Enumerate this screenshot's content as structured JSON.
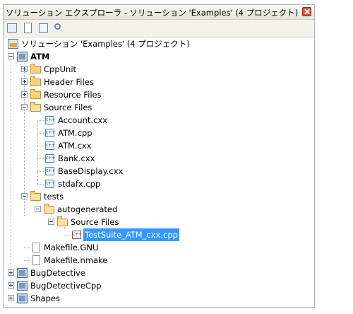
{
  "window": {
    "title": "ソリューション エクスプローラ - ソリューション 'Examples' (4 プロジェクト)"
  },
  "toolbar": {
    "buttons": [
      {
        "icon": "properties-icon"
      },
      {
        "icon": "show-all-files-icon"
      },
      {
        "icon": "refresh-icon"
      },
      {
        "icon": "view-class-diagram-icon"
      }
    ]
  },
  "tree": {
    "solution": "ソリューション 'Examples' (4 プロジェクト)",
    "atm": "ATM",
    "cppunit": "CppUnit",
    "header_files": "Header Files",
    "resource_files": "Resource Files",
    "source_files": "Source Files",
    "files": [
      "Account.cxx",
      "ATM.cpp",
      "ATM.cxx",
      "Bank.cxx",
      "BaseDisplay.cxx",
      "stdafx.cpp"
    ],
    "tests": "tests",
    "autogenerated": "autogenerated",
    "tests_source_files": "Source Files",
    "selected_file": "TestSuite_ATM_cxx.cpp",
    "makefile_gnu": "Makefile.GNU",
    "makefile_nmake": "Makefile.nmake",
    "bugdetective": "BugDetective",
    "bugdetectivecpp": "BugDetectiveCpp",
    "shapes": "Shapes"
  },
  "colors": {
    "selection": "#3399ff",
    "close_button": "#d8553a",
    "folder": "#f3d37a"
  }
}
